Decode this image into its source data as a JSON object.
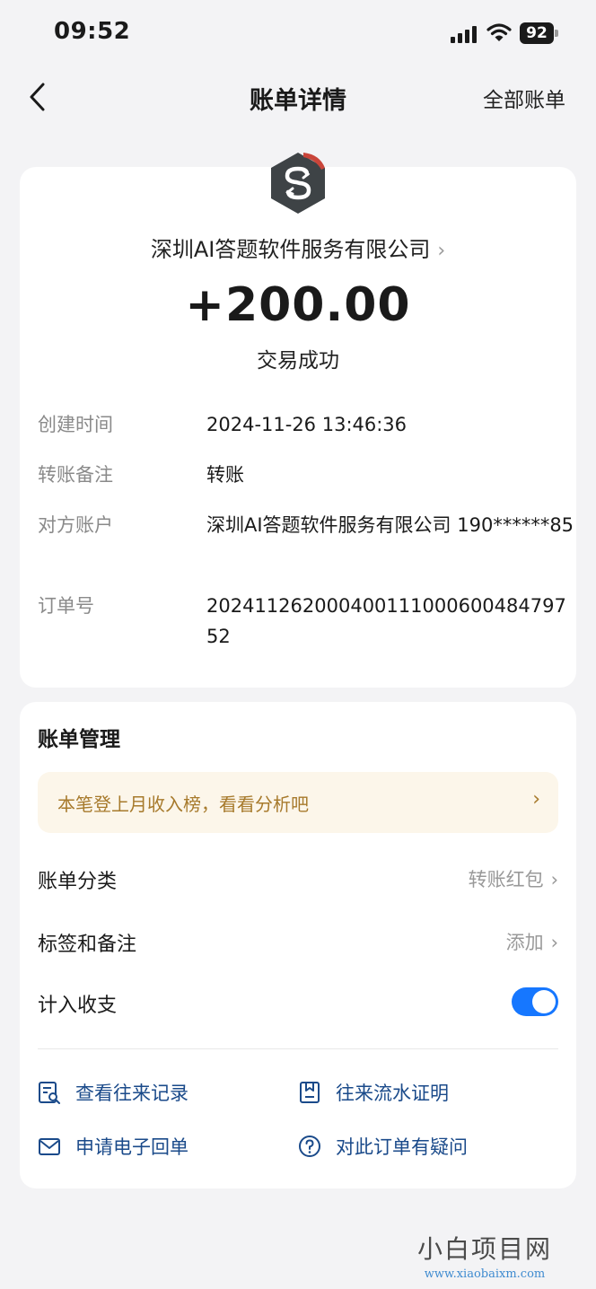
{
  "status_bar": {
    "time": "09:52",
    "battery": "92"
  },
  "nav": {
    "title": "账单详情",
    "right": "全部账单"
  },
  "bill": {
    "merchant": "深圳AI答题软件服务有限公司",
    "amount": "+200.00",
    "status": "交易成功",
    "details": [
      {
        "label": "创建时间",
        "value": "2024-11-26 13:46:36"
      },
      {
        "label": "转账备注",
        "value": "转账"
      },
      {
        "label": "对方账户",
        "value": "深圳AI答题软件服务有限公司 190******85"
      },
      {
        "label": "订单号",
        "value": "20241126200040011100060048479752"
      }
    ]
  },
  "manage": {
    "title": "账单管理",
    "banner": "本笔登上月收入榜，看看分析吧",
    "rows": [
      {
        "label": "账单分类",
        "value": "转账红包"
      },
      {
        "label": "标签和备注",
        "value": "添加"
      },
      {
        "label": "计入收支",
        "toggle_on": true
      }
    ],
    "actions": [
      {
        "label": "查看往来记录",
        "icon": "records-search-icon"
      },
      {
        "label": "往来流水证明",
        "icon": "statement-proof-icon"
      },
      {
        "label": "申请电子回单",
        "icon": "mail-icon"
      },
      {
        "label": "对此订单有疑问",
        "icon": "question-icon"
      }
    ]
  },
  "watermark": {
    "cn": "小白项目网",
    "en": "www.xiaobaixm.com"
  },
  "colors": {
    "accent": "#1677ff",
    "link": "#1a4a8a",
    "banner_bg": "#fcf6ea",
    "banner_text": "#a77a2c"
  }
}
